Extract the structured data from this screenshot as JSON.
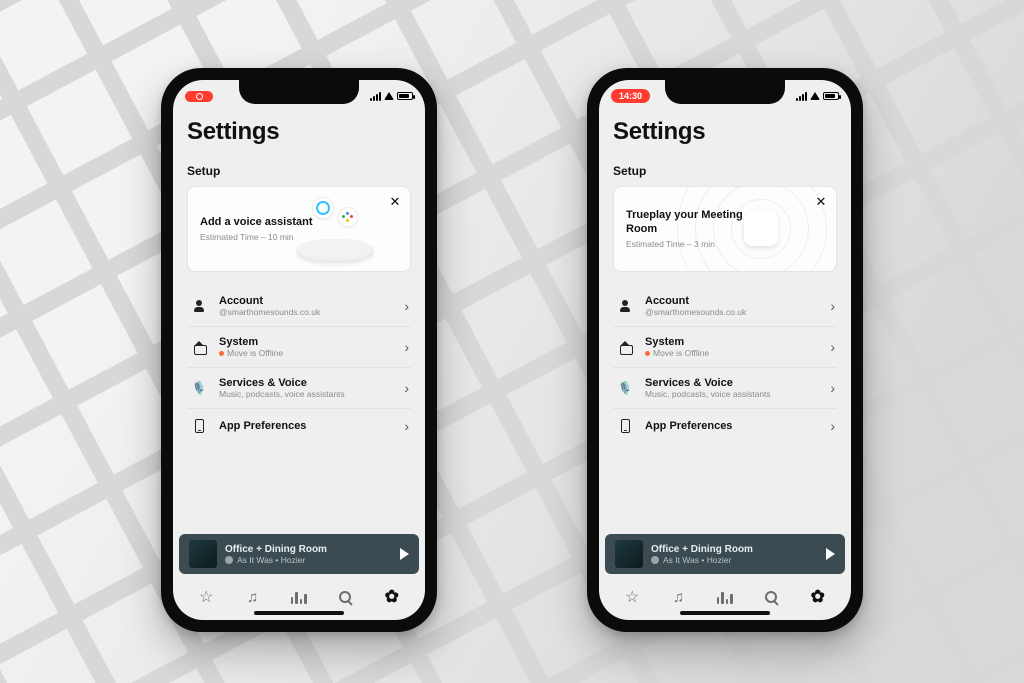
{
  "page_title": "Settings",
  "section_label": "Setup",
  "phones": {
    "left": {
      "status_pill_kind": "record",
      "status_pill_text": "",
      "card": {
        "title": "Add a voice assistant",
        "subtitle": "Estimated Time – 10 min"
      }
    },
    "right": {
      "status_pill_kind": "time",
      "status_pill_text": "14:30",
      "card": {
        "title": "Trueplay your Meeting Room",
        "subtitle": "Estimated Time – 3 min"
      }
    }
  },
  "list": {
    "account": {
      "label": "Account",
      "sub": "@smarthomesounds.co.uk"
    },
    "system": {
      "label": "System",
      "sub": "Move is Offline"
    },
    "services": {
      "label": "Services & Voice",
      "sub": "Music, podcasts, voice assistants"
    },
    "appprefs": {
      "label": "App Preferences"
    }
  },
  "now_playing": {
    "room": "Office + Dining Room",
    "track": "As It Was • Hozier"
  },
  "tabs": [
    "favorites",
    "music",
    "rooms",
    "search",
    "settings"
  ]
}
